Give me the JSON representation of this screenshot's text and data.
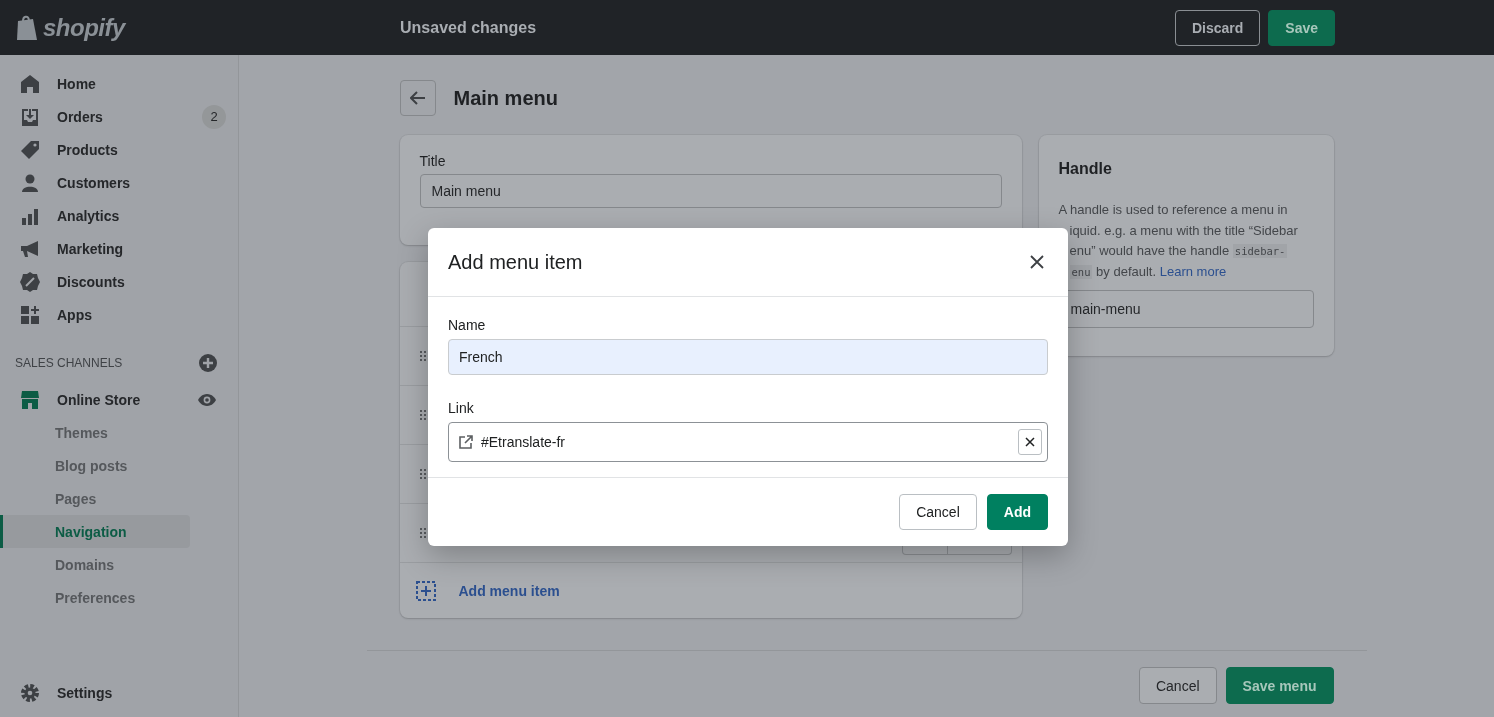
{
  "topbar": {
    "logo": "shopify",
    "status": "Unsaved changes",
    "buttons": [
      {
        "label": "Discard",
        "kind": "secondary"
      },
      {
        "label": "Save",
        "kind": "primary"
      }
    ]
  },
  "sidebar": {
    "items": [
      {
        "label": "Home",
        "selected": false
      },
      {
        "label": "Orders",
        "badge": "2",
        "selected": false
      },
      {
        "label": "Products",
        "selected": false
      },
      {
        "label": "Customers",
        "selected": false
      },
      {
        "label": "Analytics",
        "selected": false
      },
      {
        "label": "Marketing",
        "selected": false
      },
      {
        "label": "Discounts",
        "selected": false
      },
      {
        "label": "Apps",
        "selected": false
      }
    ],
    "sales_channels": {
      "heading": "SALES CHANNELS",
      "channel": {
        "label": "Online Store",
        "children": [
          {
            "label": "Themes",
            "selected": false
          },
          {
            "label": "Blog posts",
            "selected": false
          },
          {
            "label": "Pages",
            "selected": false
          },
          {
            "label": "Navigation",
            "selected": true
          },
          {
            "label": "Domains",
            "selected": false
          },
          {
            "label": "Preferences",
            "selected": false
          }
        ]
      }
    },
    "settings": "Settings"
  },
  "page": {
    "title": "Main menu",
    "title_card": {
      "label": "Title",
      "value": "Main menu"
    },
    "menu_card": {
      "add_item": "Add menu item"
    },
    "handle_card": {
      "heading": "Handle",
      "description_lines": [
        [
          {
            "kind": "text",
            "text": "A handle is used to reference a menu in"
          }
        ],
        [
          {
            "kind": "text",
            "text": "iquid. e.g. a menu with the title “Sidebar"
          }
        ],
        [
          {
            "kind": "text",
            "text": "enu” would have the handle"
          },
          {
            "kind": "code",
            "text": "sidebar-"
          }
        ],
        [
          {
            "kind": "code",
            "text": "enu"
          },
          {
            "kind": "text",
            "text": "by default."
          },
          {
            "kind": "link",
            "text": "Learn more"
          }
        ]
      ],
      "value": "main-menu"
    },
    "footer_buttons": [
      {
        "label": "Cancel",
        "kind": "secondary"
      },
      {
        "label": "Save menu",
        "kind": "primary"
      }
    ]
  },
  "modal": {
    "title": "Add menu item",
    "fields": [
      {
        "label": "Name",
        "value": "French",
        "autofilled": true
      },
      {
        "label": "Link",
        "value": "#Etranslate-fr",
        "autofilled": false
      }
    ],
    "buttons": [
      {
        "label": "Cancel",
        "kind": "secondary"
      },
      {
        "label": "Add",
        "kind": "primary"
      }
    ]
  }
}
